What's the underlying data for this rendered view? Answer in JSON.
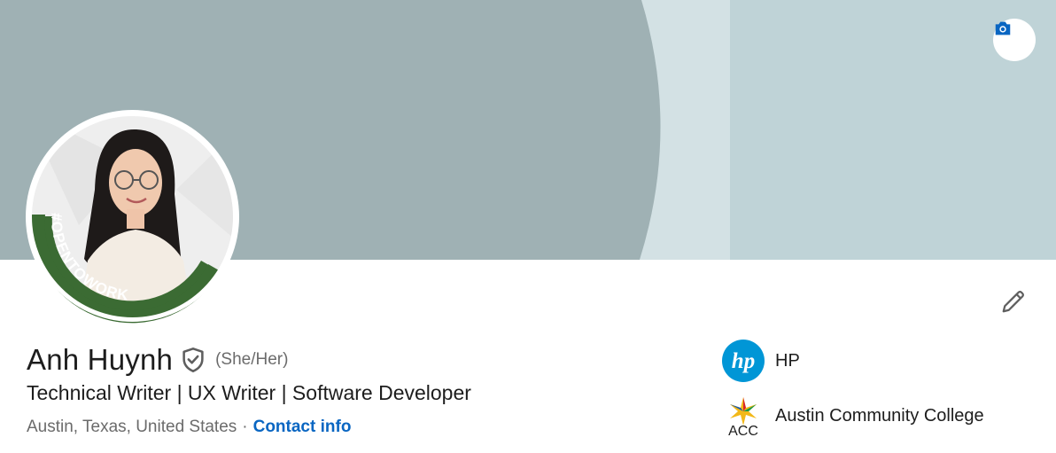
{
  "banner": {
    "colors": {
      "left": "#9fb1b4",
      "middle": "#d3e1e4",
      "right": "#bfd3d7"
    }
  },
  "avatar": {
    "badge_text": "#OPENTOWORK",
    "badge_color": "#3b6b33"
  },
  "profile": {
    "name": "Anh Huynh",
    "pronouns": "(She/Her)",
    "headline": "Technical Writer | UX Writer | Software Developer",
    "location": "Austin, Texas, United States",
    "separator": "·",
    "contact_info": "Contact info"
  },
  "organizations": [
    {
      "name": "HP",
      "logo_text": "hp",
      "logo_color": "#0096d6"
    },
    {
      "name": "Austin Community College",
      "logo_text": "ACC"
    }
  ],
  "icons": {
    "camera": "camera-icon",
    "edit": "pencil-icon",
    "verified": "shield-check-icon"
  },
  "accent_color": "#0a66c2"
}
